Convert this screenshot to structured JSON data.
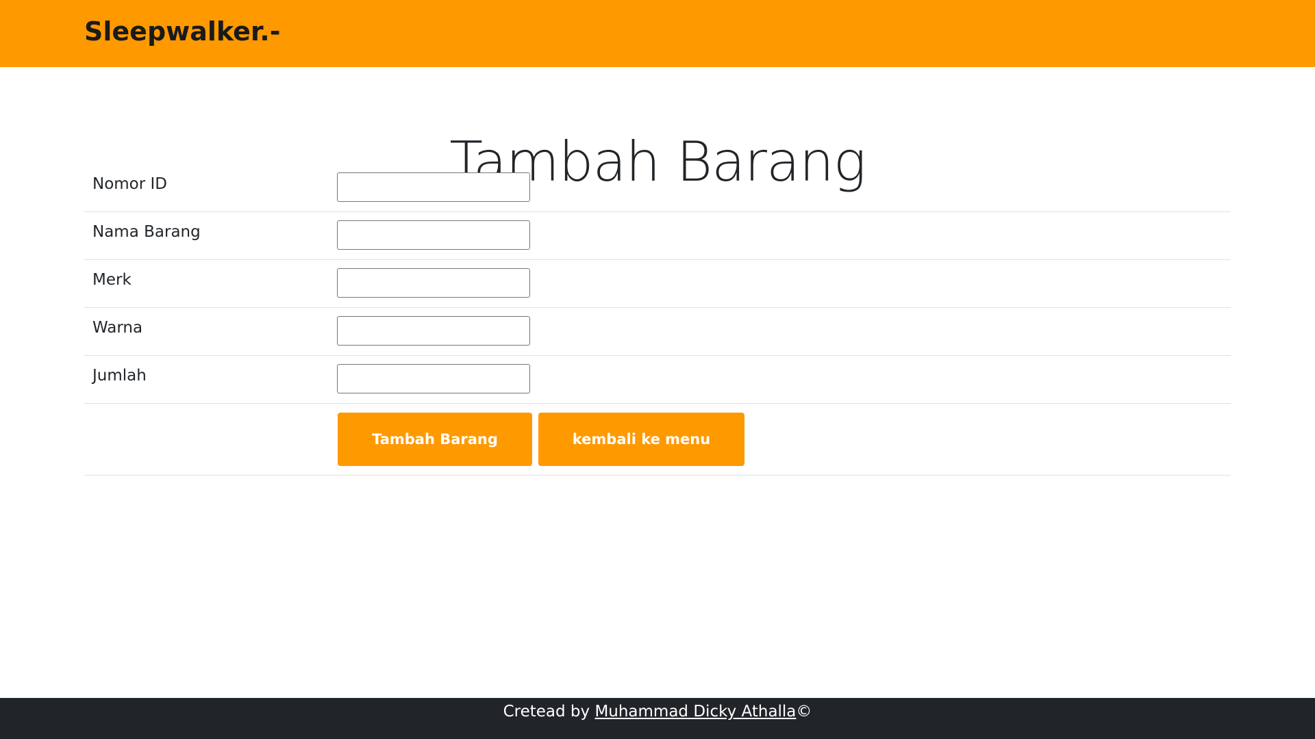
{
  "navbar": {
    "brand": "Sleepwalker.-",
    "background": "#ff9900"
  },
  "page": {
    "title": "Tambah Barang"
  },
  "form": {
    "fields": [
      {
        "label": "Nomor ID",
        "value": "",
        "placeholder": ""
      },
      {
        "label": "Nama Barang",
        "value": "",
        "placeholder": ""
      },
      {
        "label": "Merk",
        "value": "",
        "placeholder": ""
      },
      {
        "label": "Warna",
        "value": "",
        "placeholder": ""
      },
      {
        "label": "Jumlah",
        "value": "",
        "placeholder": ""
      }
    ],
    "submit_label": "Tambah Barang",
    "back_label": "kembali ke menu",
    "accent": "#ff9900"
  },
  "footer": {
    "prefix": "Cretead by ",
    "author_link": "Muhammad Dicky Athalla",
    "suffix": "©",
    "background": "#212529"
  }
}
